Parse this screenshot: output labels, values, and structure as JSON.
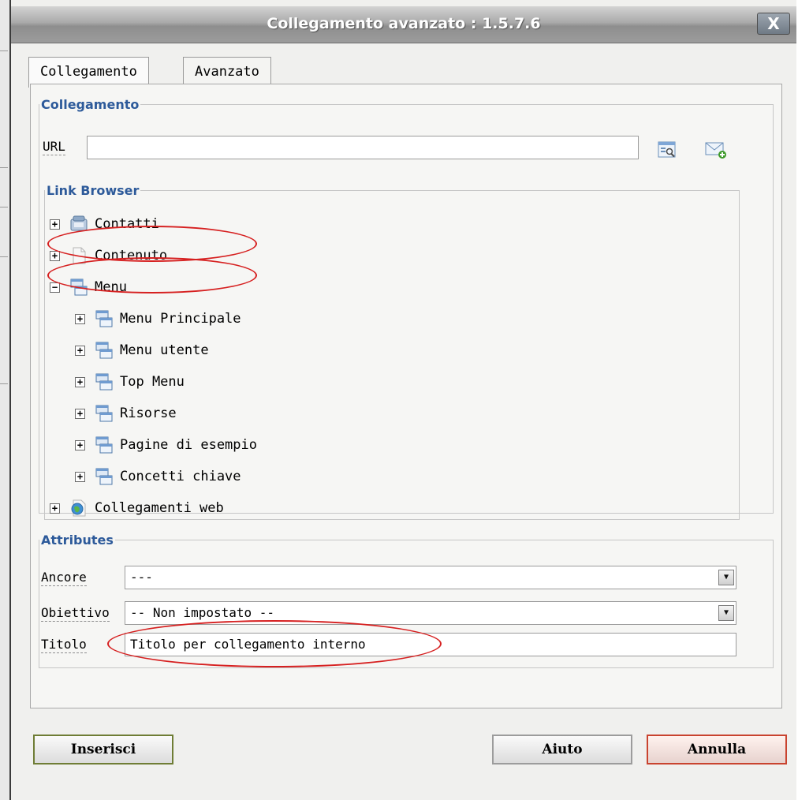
{
  "window": {
    "title": "Collegamento avanzato : 1.5.7.6",
    "close_label": "X"
  },
  "tabs": [
    {
      "label": "Collegamento"
    },
    {
      "label": "Avanzato"
    }
  ],
  "link_group": {
    "legend": "Collegamento",
    "url_label": "URL",
    "url_value": ""
  },
  "browser": {
    "legend": "Link Browser",
    "items": [
      {
        "label": "Contatti",
        "toggle": "+",
        "icon": "contacts-icon"
      },
      {
        "label": "Contenuto",
        "toggle": "+",
        "icon": "document-icon"
      },
      {
        "label": "Menu",
        "toggle": "−",
        "icon": "menu-icon"
      },
      {
        "label": "Menu Principale",
        "toggle": "+",
        "icon": "menu-icon"
      },
      {
        "label": "Menu utente",
        "toggle": "+",
        "icon": "menu-icon"
      },
      {
        "label": "Top Menu",
        "toggle": "+",
        "icon": "menu-icon"
      },
      {
        "label": "Risorse",
        "toggle": "+",
        "icon": "menu-icon"
      },
      {
        "label": "Pagine di esempio",
        "toggle": "+",
        "icon": "menu-icon"
      },
      {
        "label": "Concetti chiave",
        "toggle": "+",
        "icon": "menu-icon"
      },
      {
        "label": "Collegamenti web",
        "toggle": "+",
        "icon": "globe-icon"
      }
    ]
  },
  "attributes": {
    "legend": "Attributes",
    "anchor_label": "Ancore",
    "anchor_value": "---",
    "target_label": "Obiettivo",
    "target_value": "-- Non impostato --",
    "title_label": "Titolo",
    "title_value": "Titolo per collegamento interno"
  },
  "buttons": {
    "insert": "Inserisci",
    "help": "Aiuto",
    "cancel": "Annulla"
  }
}
